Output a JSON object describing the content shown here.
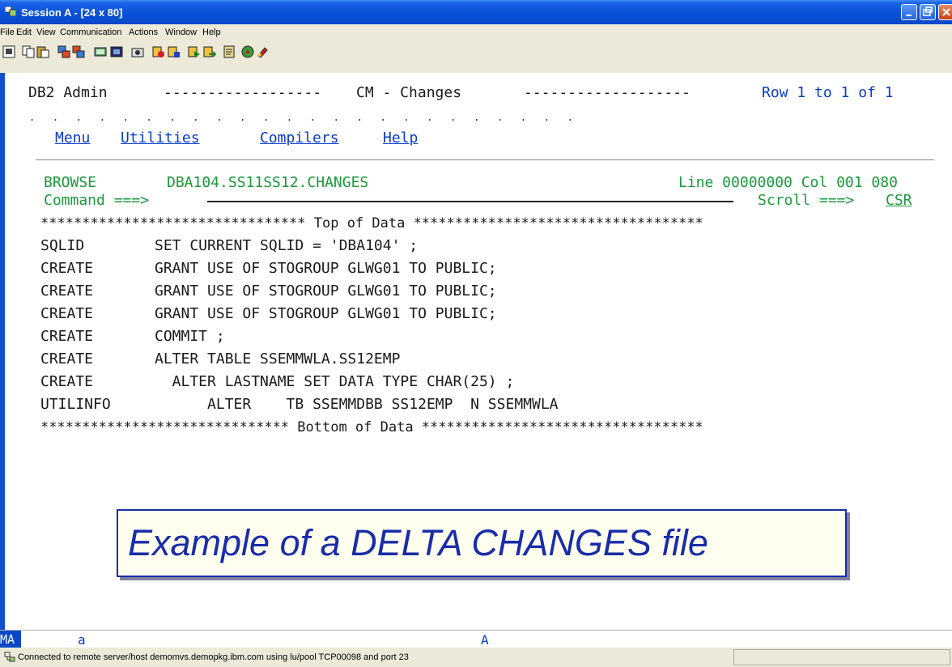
{
  "window": {
    "title": "Session A - [24 x 80]"
  },
  "menu": [
    "File",
    "Edit",
    "View",
    "Communication",
    "Actions",
    "Window",
    "Help"
  ],
  "screen": {
    "header_left": "DB2 Admin",
    "header_dash1": "------------------",
    "header_center": "CM - Changes",
    "header_dash2": "-------------------",
    "header_right": "Row 1 to 1 of 1",
    "dots": ".   .   .   .   .   .   .   .   .   .   .   .   .   .   .   .   .   .   .   .   .   .   .   .",
    "actions": [
      "Menu",
      "Utilities",
      "Compilers",
      "Help"
    ],
    "browse_label": "BROWSE",
    "dataset": "DBA104.SS11SS12.CHANGES",
    "line_col": "Line 00000000 Col 001 080",
    "command_label": "Command ===>",
    "scroll_label": "Scroll ===>",
    "scroll_value": "CSR",
    "top_of_data": "******************************** Top of Data ***********************************",
    "bottom_of_data": "****************************** Bottom of Data **********************************",
    "rows": [
      {
        "type": "SQLID",
        "text": "SET CURRENT SQLID = 'DBA104' ;"
      },
      {
        "type": "CREATE",
        "text": "GRANT USE OF STOGROUP GLWG01 TO PUBLIC;"
      },
      {
        "type": "CREATE",
        "text": "GRANT USE OF STOGROUP GLWG01 TO PUBLIC;"
      },
      {
        "type": "CREATE",
        "text": "GRANT USE OF STOGROUP GLWG01 TO PUBLIC;"
      },
      {
        "type": "CREATE",
        "text": "COMMIT ;"
      },
      {
        "type": "CREATE",
        "text": "ALTER TABLE SSEMMWLA.SS12EMP"
      },
      {
        "type": "CREATE",
        "text": "  ALTER LASTNAME SET DATA TYPE CHAR(25) ;"
      },
      {
        "type": "UTILINFO",
        "text": "      ALTER    TB SSEMMDBB SS12EMP  N SSEMMWLA"
      }
    ]
  },
  "callout": "Example of a DELTA CHANGES file",
  "oia": {
    "indicator": "MA",
    "mode": "a",
    "field": "A"
  },
  "status": "Connected to remote server/host demomvs.demopkg.ibm.com using lu/pool TCP00098 and port 23",
  "colors": {
    "title_bar": "#0a50d8",
    "green_text": "#1a9a3a",
    "blue_text": "#0a3cc8",
    "callout_border": "#1a2ca8"
  },
  "icons": [
    "app-icon",
    "minimize-icon",
    "maximize-icon",
    "close-icon",
    "status-connection-icon"
  ]
}
